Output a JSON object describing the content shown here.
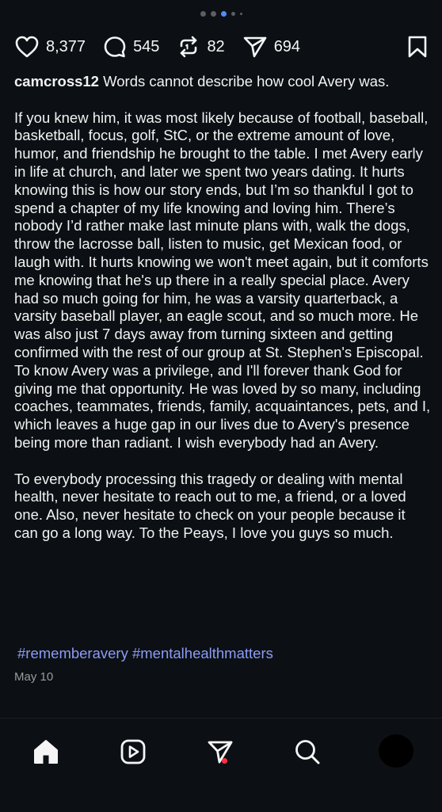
{
  "carousel": {
    "total": 5,
    "active_index": 2
  },
  "actions": {
    "likes": "8,377",
    "comments": "545",
    "reposts": "82",
    "shares": "694"
  },
  "post": {
    "username": "camcross12",
    "first_line": "Words cannot describe how cool Avery was.",
    "paragraph_1": "If you knew him, it was most likely because of football, baseball, basketball, focus, golf, StC, or the extreme amount of love, humor, and friendship he brought to the table. I met Avery early in life at church, and later we spent two years dating. It hurts knowing this is how our story ends, but I’m so thankful I got to spend a chapter of my life knowing and loving him. There’s nobody I’d rather make last minute plans with, walk the dogs, throw the lacrosse ball, listen to music, get Mexican food, or laugh with. It hurts knowing we won't meet again, but it comforts me knowing that he's up there in a really special place. Avery had so much going for him, he was a varsity quarterback, a varsity baseball player, an eagle scout, and so much more. He was also just 7 days away from turning sixteen and getting confirmed with the rest of our group at St. Stephen's Episcopal. To know Avery was a privilege, and I'll forever thank God for giving me that opportunity. He was loved by so many, including coaches, teammates, friends, family, acquaintances, pets, and I, which leaves a huge gap in our lives due to Avery's presence being more than radiant. I wish everybody had an Avery.",
    "paragraph_2": "To everybody processing this tragedy or dealing with mental health, never hesitate to reach out to me, a friend, or a loved one. Also, never hesitate to check on your people because it can go a long way. To the Peays, I love you guys so much.",
    "hashtags": "#rememberavery #mentalhealthmatters",
    "date": "May 10"
  },
  "icons": {
    "like": "heart-icon",
    "comment": "comment-bubble-icon",
    "repost": "repost-icon",
    "share": "paper-plane-icon",
    "save": "bookmark-icon"
  },
  "nav": [
    "home-icon",
    "reels-icon",
    "messages-icon",
    "search-icon",
    "profile-avatar"
  ],
  "colors": {
    "background": "#0c1014",
    "text": "#f5f5f5",
    "hashtag": "#8b9cf5",
    "active_dot": "#4f8cff",
    "notification": "#ff3040"
  }
}
